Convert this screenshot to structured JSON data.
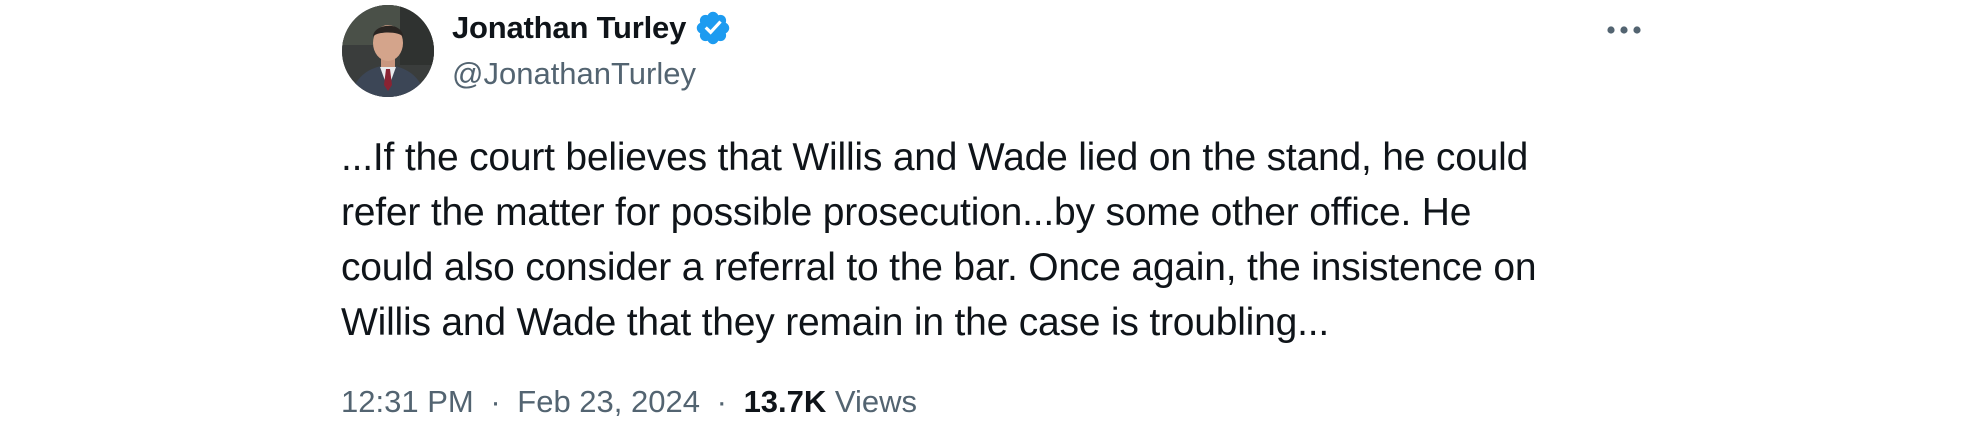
{
  "author": {
    "display_name": "Jonathan Turley",
    "handle": "@JonathanTurley",
    "verified": true,
    "avatar_icon": "person-portrait-avatar",
    "verified_color": "#1d9bf0"
  },
  "tweet": {
    "text": "...If the court believes that Willis and Wade lied on the stand, he could\nrefer the matter for possible prosecution...by some other office.  He\ncould also consider a referral to the bar. Once again, the insistence on\nWillis and Wade that they remain in the case is troubling..."
  },
  "meta": {
    "time": "12:31 PM",
    "separator": "·",
    "date": "Feb 23, 2024",
    "views_count": "13.7K",
    "views_label": "Views"
  },
  "actions": {
    "more_icon": "more-horizontal-icon"
  },
  "colors": {
    "text_primary": "#0f1419",
    "text_secondary": "#536471",
    "background": "#ffffff"
  }
}
